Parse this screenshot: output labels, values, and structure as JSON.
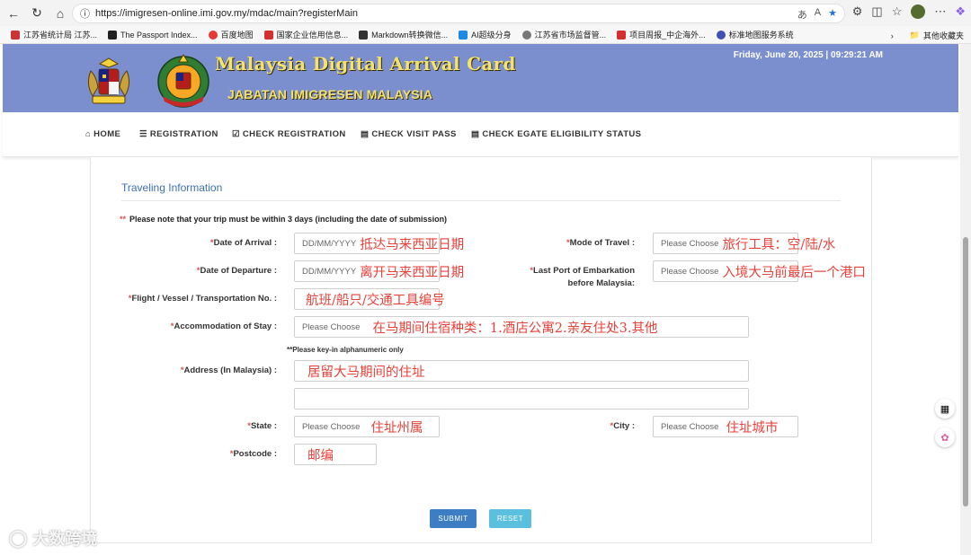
{
  "browser": {
    "url": "https://imigresen-online.imi.gov.my/mdac/main?registerMain",
    "bookmarks": [
      "江苏省统计局 江苏...",
      "The Passport Index...",
      "百度地图",
      "国家企业信用信息...",
      "Markdown转换微信...",
      "AI超级分身",
      "江苏省市场监督管...",
      "项目周报_中企海外...",
      "标准地图服务系统"
    ],
    "other_bookmarks": "其他收藏夹"
  },
  "header": {
    "title": "Malaysia Digital Arrival Card",
    "subtitle": "JABATAN IMIGRESEN MALAYSIA",
    "datetime": "Friday, June 20, 2025 | 09:29:21 AM",
    "logo_text": "IMIGRESEN MALAYSIA"
  },
  "nav": {
    "home": "HOME",
    "registration": "REGISTRATION",
    "check_registration": "CHECK REGISTRATION",
    "check_visit_pass": "CHECK VISIT PASS",
    "check_egate": "CHECK EGATE ELIGIBILITY STATUS"
  },
  "form": {
    "section_title": "Traveling Information",
    "note_marker": "**",
    "note": "Please note that your trip must be within 3 days (including the date of submission)",
    "required": "*",
    "date_of_arrival_label": "Date of Arrival :",
    "date_of_arrival_placeholder": "DD/MM/YYYY",
    "date_of_departure_label": "Date of Departure :",
    "date_of_departure_placeholder": "DD/MM/YYYY",
    "mode_of_travel_label": "Mode of Travel :",
    "mode_of_travel_value": "Please Choose",
    "last_port_label_1": "Last Port of Embarkation",
    "last_port_label_2": "before Malaysia:",
    "last_port_value": "Please Choose",
    "flight_label": "Flight / Vessel / Transportation No. :",
    "accommodation_label": "Accommodation of Stay :",
    "accommodation_value": "Please Choose",
    "alphanumeric_hint": "**Please key-in alphanumeric only",
    "address_label": "Address (In Malaysia) :",
    "state_label": "State :",
    "state_value": "Please Choose",
    "city_label": "City :",
    "city_value": "Please Choose",
    "postcode_label": "Postcode :",
    "submit": "SUBMIT",
    "reset": "RESET"
  },
  "annotations": {
    "arrival": "抵达马来西亚日期",
    "departure": "离开马来西亚日期",
    "mode": "旅行工具：空/陆/水",
    "last_port": "入境大马前最后一个港口",
    "flight": "航班/船只/交通工具编号",
    "accommodation": "在马期间住宿种类：1.酒店公寓2.亲友住处3.其他",
    "address": "居留大马期间的住址",
    "state": "住址州属",
    "city": "住址城市",
    "postcode": "邮编"
  },
  "watermark": "大数跨境",
  "colors": {
    "header_bg": "#7b8fcf",
    "title": "#f3e36b",
    "section_title": "#3d6fb6",
    "annotation": "#e8413a",
    "submit": "#3c7dc4",
    "reset": "#5bc0de"
  }
}
